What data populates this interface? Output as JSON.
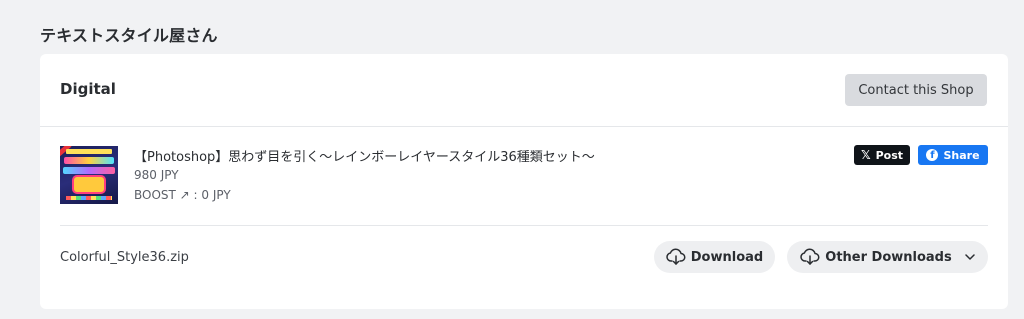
{
  "shop": {
    "name": "テキストスタイル屋さん"
  },
  "card": {
    "category": "Digital",
    "contact_label": "Contact this Shop"
  },
  "item": {
    "title": "【Photoshop】思わず目を引く〜レインボーレイヤースタイル36種類セット〜",
    "price": "980 JPY",
    "boost": "BOOST ↗ : 0 JPY",
    "thumbnail_icon": "product-thumbnail-rainbow-layer-style"
  },
  "share": {
    "x_label": "Post",
    "x_glyph": "𝕏",
    "fb_label": "Share",
    "fb_glyph": "f",
    "x_color": "#0f1419",
    "fb_color": "#1877f2"
  },
  "file": {
    "name": "Colorful_Style36.zip",
    "download_label": "Download",
    "other_label": "Other Downloads",
    "download_icon": "cloud-download-icon",
    "other_icon": "cloud-download-icon",
    "chevron_icon": "chevron-down-icon"
  },
  "colors": {
    "page_bg": "#f1f2f4",
    "card_bg": "#ffffff",
    "button_bg": "#eeeff1",
    "contact_bg": "#d9dbdf"
  }
}
